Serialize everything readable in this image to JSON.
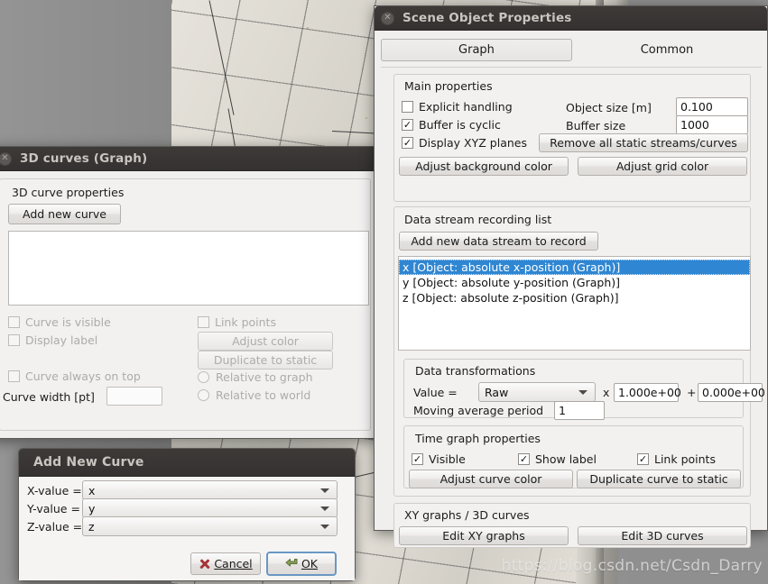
{
  "scene": {
    "watermark": "https://blog.csdn.net/Csdn_Darry"
  },
  "scene_object_properties": {
    "title": "Scene Object Properties",
    "close_icon": "close-icon",
    "tabs": [
      {
        "label": "Graph",
        "active": true
      },
      {
        "label": "Common",
        "active": false
      }
    ],
    "main_properties": {
      "title": "Main properties",
      "checkboxes": [
        {
          "label": "Explicit handling",
          "checked": false
        },
        {
          "label": "Buffer is cyclic",
          "checked": true
        },
        {
          "label": "Display XYZ planes",
          "checked": true
        }
      ],
      "object_size_label": "Object size [m]",
      "object_size_value": "0.100",
      "buffer_size_label": "Buffer size",
      "buffer_size_value": "1000",
      "remove_streams_button": "Remove all static streams/curves",
      "adjust_background_button": "Adjust background color",
      "adjust_grid_button": "Adjust grid color"
    },
    "data_stream_recording": {
      "title": "Data stream recording list",
      "add_button": "Add new data stream to record",
      "items": [
        {
          "label": "x [Object: absolute x-position (Graph)]",
          "selected": true
        },
        {
          "label": "y [Object: absolute y-position (Graph)]",
          "selected": false
        },
        {
          "label": "z [Object: absolute z-position (Graph)]",
          "selected": false
        }
      ]
    },
    "data_transformations": {
      "title": "Data transformations",
      "value_label": "Value =",
      "mode_value": "Raw",
      "multiply_symbol": "x",
      "multiplier_value": "1.000e+00",
      "plus_symbol": "+",
      "offset_value": "0.000e+00",
      "moving_average_label": "Moving average period",
      "moving_average_value": "1"
    },
    "time_graph_properties": {
      "title": "Time graph properties",
      "checkboxes": [
        {
          "label": "Visible",
          "checked": true
        },
        {
          "label": "Show label",
          "checked": true
        },
        {
          "label": "Link points",
          "checked": true
        }
      ],
      "adjust_curve_color_button": "Adjust curve color",
      "duplicate_curve_button": "Duplicate curve to static"
    },
    "xy_graphs_3d_curves": {
      "title": "XY graphs / 3D curves",
      "edit_xy_button": "Edit XY graphs",
      "edit_3d_button": "Edit 3D curves"
    }
  },
  "curves_3d_window": {
    "title": "3D curves (Graph)",
    "close_icon": "close-icon",
    "section_title": "3D curve properties",
    "add_new_curve_button": "Add new curve",
    "list_items": [],
    "checkboxes": [
      {
        "label": "Curve is visible",
        "checked": false,
        "disabled": true
      },
      {
        "label": "Display label",
        "checked": false,
        "disabled": true
      },
      {
        "label": "Link points",
        "checked": false,
        "disabled": true
      },
      {
        "label": "Curve always on top",
        "checked": false,
        "disabled": true
      }
    ],
    "adjust_color_button": "Adjust color",
    "duplicate_to_static_button": "Duplicate to static",
    "radios": [
      {
        "label": "Relative to graph",
        "selected": false
      },
      {
        "label": "Relative to world",
        "selected": false
      }
    ],
    "curve_width_label": "Curve width [pt]",
    "curve_width_value": ""
  },
  "add_new_curve_dialog": {
    "title": "Add New Curve",
    "rows": [
      {
        "label": "X-value =",
        "value": "x"
      },
      {
        "label": "Y-value =",
        "value": "y"
      },
      {
        "label": "Z-value =",
        "value": "z"
      }
    ],
    "cancel_button": "Cancel",
    "ok_button": "OK"
  },
  "colors": {
    "titlebar": "#3a3735",
    "selection_blue": "#2f86d2",
    "window_bg": "#f0efee",
    "default_button_border": "#6a97c4",
    "cancel_icon_red": "#a4353a",
    "ok_icon_green": "#7f9b4e"
  }
}
